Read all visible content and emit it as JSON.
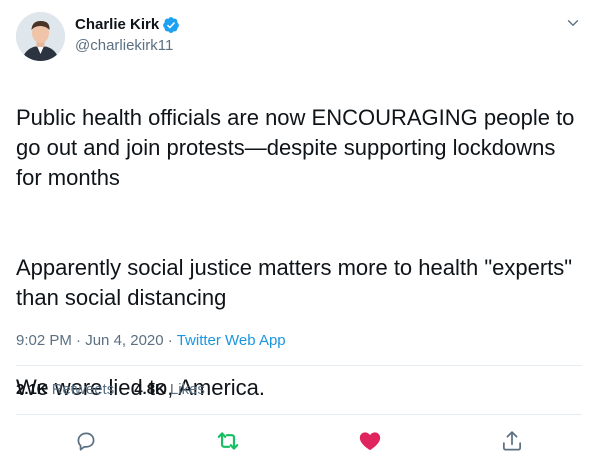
{
  "author": {
    "display_name": "Charlie Kirk",
    "handle": "@charliekirk11",
    "verified": true,
    "avatar_icon": "user-avatar"
  },
  "tweet": {
    "paragraphs": [
      "Public health officials are now ENCOURAGING people to go out and join protests—despite supporting lockdowns for months",
      "Apparently social justice matters more to health \"experts\" than social distancing",
      "We were lied to, America."
    ],
    "time": "9:02 PM",
    "separator": " · ",
    "date": "Jun 4, 2020",
    "source": "Twitter Web App"
  },
  "stats": {
    "retweets_count": "2.1K",
    "retweets_label": "Retweets",
    "likes_count": "4.8K",
    "likes_label": "Likes"
  },
  "actions": {
    "reply_icon": "reply-icon",
    "retweet_icon": "retweet-icon",
    "like_icon": "heart-icon",
    "share_icon": "share-icon"
  },
  "colors": {
    "text": "#0f1419",
    "secondary": "#5b7083",
    "link": "#1b95e0",
    "retweet_green": "#17bf63",
    "like_red": "#e0245e",
    "verified_blue": "#1da1f2"
  }
}
